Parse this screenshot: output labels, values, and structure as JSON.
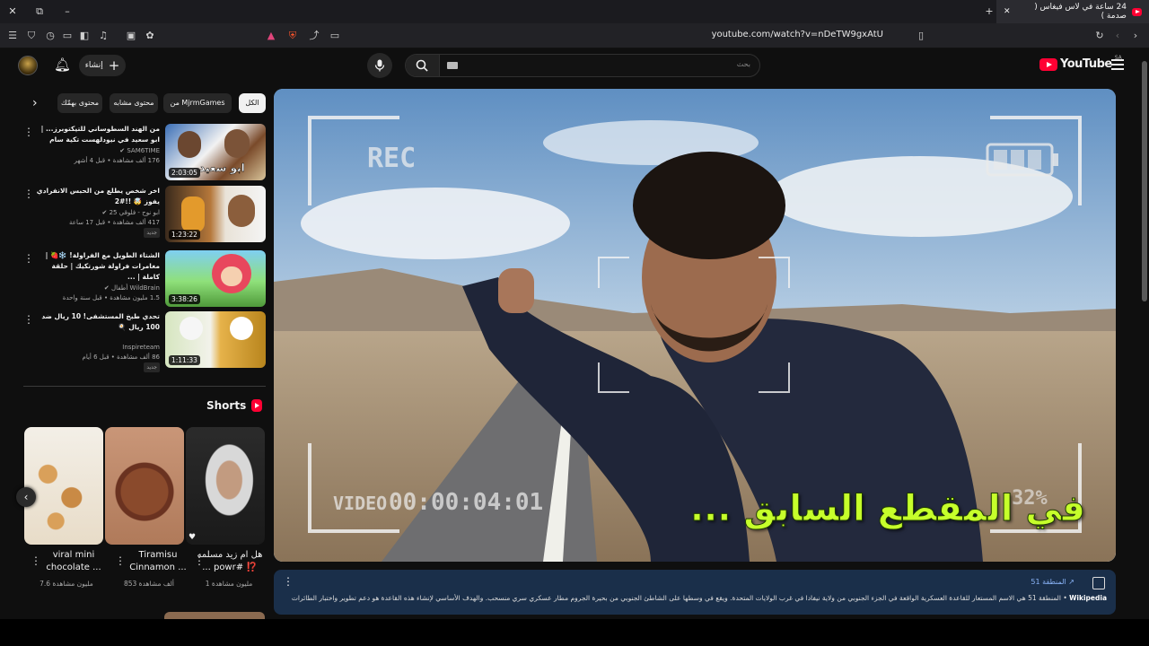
{
  "browser": {
    "tab_title": "24 ساعة في لاس فيغاس ( صدمة )",
    "url": "youtube.com/watch?v=nDeTW9gxAtU"
  },
  "header": {
    "search_placeholder": "بحث",
    "create_label": "إنشاء",
    "logo_text": "YouTube",
    "country_code": "SA"
  },
  "chips": [
    "الكل",
    "من MjrmGames",
    "محتوى مشابه",
    "محتوى بهمّك"
  ],
  "recommendations": [
    {
      "title": "من الهند السطوساني للتيكتوبرز... | ابو سعيد في نيودلهست تكية سام",
      "channel": "SAM6TIME",
      "stats": "176 ألف مشاهدة • قبل 4 أشهر",
      "duration": "2:03:05",
      "badge": ""
    },
    {
      "title": "اخر شخص يطلع من الحبس الانفرادي يفوز 🤯 !!#2",
      "channel": "ابو نوح - فلوقي 25",
      "stats": "417 ألف مشاهدة • قبل 17 ساعة",
      "duration": "1:23:22",
      "badge": "جديد"
    },
    {
      "title": "الشتاء الطويل مع الفراولة! ❄️🍓 | مغامرات فراولة شورتكيك | حلقة كاملة | ...",
      "channel": "WildBrain أطفال",
      "stats": "1.5 مليون مشاهدة • قبل سنة واحدة",
      "duration": "3:38:26",
      "badge": ""
    },
    {
      "title": "تحدي طبخ المستشفى! 10 ريال ضد 100 ريال 🍳",
      "channel": "Inspireteam",
      "stats": "86 ألف مشاهدة • قبل 6 أيام",
      "duration": "1:11:33",
      "badge": "جديد"
    }
  ],
  "shorts": {
    "heading": "Shorts",
    "items": [
      {
        "title": "viral mini chocolate ...",
        "views": "7.6 مليون مشاهدة"
      },
      {
        "title": "Tiramisu Cinnamon ...",
        "views": "853 ألف مشاهدة"
      },
      {
        "title": "هل ام زيد مسلمه ⁉️ #powr ...",
        "views": "1 مليون مشاهدة"
      }
    ]
  },
  "player": {
    "caption": "في المقطع السابق ...",
    "overlay_rec": "REC",
    "overlay_video": "VIDEO",
    "overlay_timecode": "00:00:04:01",
    "overlay_battery": "32%"
  },
  "wiki": {
    "title": "المنطقة 51",
    "source": "Wikipedia",
    "text": "المنطقة 51 هي الاسم المستعار للقاعدة العسكرية الواقعة في الجزء الجنوبي من ولاية نيفادا في غرب الولايات المتحدة. ويقع في وسطها على الشاطئ الجنوبي من بحيرة الجروم مطار عسكري سري منسحب. والهدف الأساسي لإنشاء هذه القاعدة هو دعم تطوير واختبار الطائرات التجريبية وأنظمة الأسلحة."
  }
}
